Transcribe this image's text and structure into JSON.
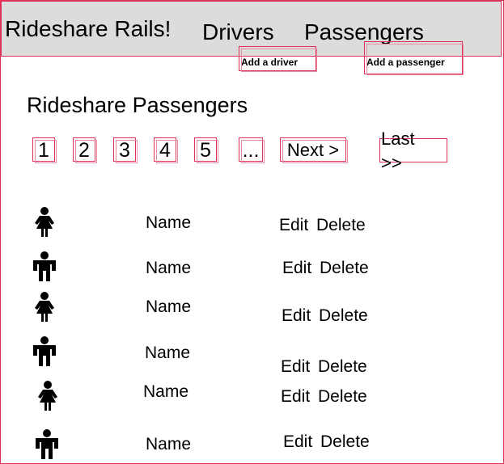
{
  "header": {
    "brand": "Rideshare Rails!",
    "nav": {
      "drivers": "Drivers",
      "passengers": "Passengers"
    },
    "add_driver": "Add a driver",
    "add_passenger": "Add a passenger"
  },
  "main": {
    "title": "Rideshare Passengers",
    "pagination": {
      "pages": [
        "1",
        "2",
        "3",
        "4",
        "5"
      ],
      "ellipsis": "...",
      "next": "Next >",
      "last": "Last >>"
    },
    "passengers": [
      {
        "icon": "female-person-icon",
        "name": "Name",
        "edit": "Edit",
        "delete": "Delete"
      },
      {
        "icon": "male-person-icon",
        "name": "Name",
        "edit": "Edit",
        "delete": "Delete"
      },
      {
        "icon": "female-person-icon",
        "name": "Name",
        "edit": "Edit",
        "delete": "Delete"
      },
      {
        "icon": "male-person-icon",
        "name": "Name",
        "edit": "Edit",
        "delete": "Delete"
      },
      {
        "icon": "female-person-icon",
        "name": "Name",
        "edit": "Edit",
        "delete": "Delete"
      },
      {
        "icon": "male-person-icon",
        "name": "Name",
        "edit": "Edit",
        "delete": "Delete"
      }
    ]
  }
}
